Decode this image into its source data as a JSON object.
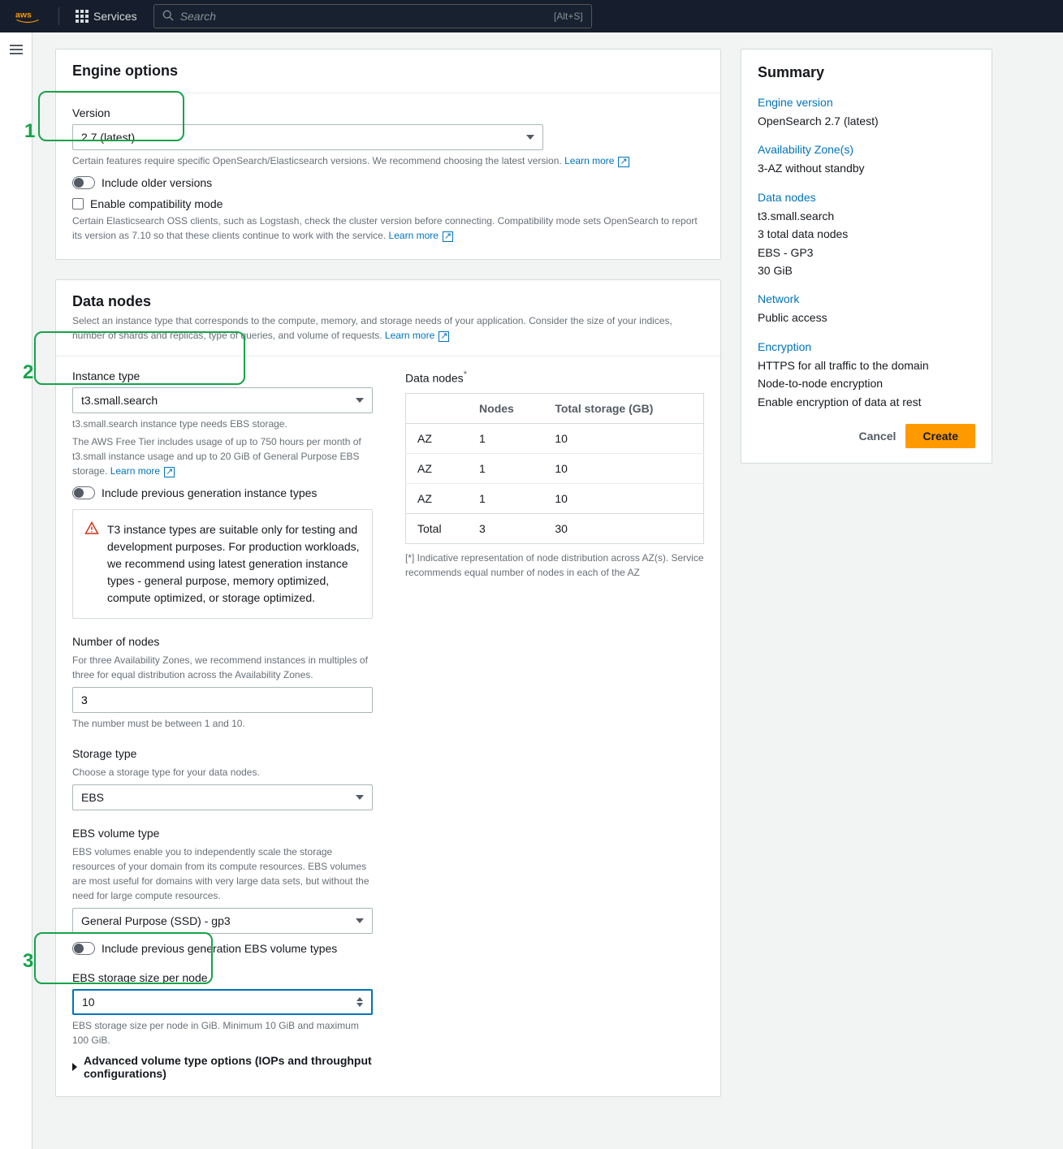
{
  "nav": {
    "services": "Services",
    "search_placeholder": "Search",
    "shortcut": "[Alt+S]"
  },
  "callouts": {
    "c1": "1",
    "c2": "2",
    "c3": "3"
  },
  "engine": {
    "title": "Engine options",
    "version_label": "Version",
    "version_value": "2.7 (latest)",
    "version_hint": "Certain features require specific OpenSearch/Elasticsearch versions. We recommend choosing the latest version.",
    "learn_more": "Learn more",
    "include_older": "Include older versions",
    "compat_label": "Enable compatibility mode",
    "compat_hint": "Certain Elasticsearch OSS clients, such as Logstash, check the cluster version before connecting. Compatibility mode sets OpenSearch to report its version as 7.10 so that these clients continue to work with the service."
  },
  "datanodes": {
    "title": "Data nodes",
    "sub": "Select an instance type that corresponds to the compute, memory, and storage needs of your application. Consider the size of your indices, number of shards and replicas, type of queries, and volume of requests.",
    "learn_more": "Learn more",
    "instance_type_label": "Instance type",
    "instance_type_value": "t3.small.search",
    "instance_type_hint1": "t3.small.search instance type needs EBS storage.",
    "instance_type_hint2_a": "The AWS Free Tier includes usage of up to 750 hours per month of t3.small instance usage and up to 20 GiB of General Purpose EBS storage.",
    "include_prev": "Include previous generation instance types",
    "warn": "T3 instance types are suitable only for testing and development purposes. For production workloads, we recommend using latest generation instance types - general purpose, memory optimized, compute optimized, or storage optimized.",
    "num_nodes_label": "Number of nodes",
    "num_nodes_hint": "For three Availability Zones, we recommend instances in multiples of three for equal distribution across the Availability Zones.",
    "num_nodes_value": "3",
    "num_nodes_constraint": "The number must be between 1 and 10.",
    "storage_type_label": "Storage type",
    "storage_type_hint": "Choose a storage type for your data nodes.",
    "storage_type_value": "EBS",
    "ebs_vol_label": "EBS volume type",
    "ebs_vol_hint": "EBS volumes enable you to independently scale the storage resources of your domain from its compute resources. EBS volumes are most useful for domains with very large data sets, but without the need for large compute resources.",
    "ebs_vol_value": "General Purpose (SSD) - gp3",
    "include_prev_ebs": "Include previous generation EBS volume types",
    "ebs_size_label": "EBS storage size per node",
    "ebs_size_value": "10",
    "ebs_size_hint": "EBS storage size per node in GiB. Minimum 10 GiB and maximum 100 GiB.",
    "advanced": "Advanced volume type options (IOPs and throughput configurations)",
    "table_title": "Data nodes",
    "table_star": "*",
    "th_nodes": "Nodes",
    "th_storage": "Total storage (GB)",
    "rows": [
      {
        "az": "AZ",
        "nodes": "1",
        "storage": "10"
      },
      {
        "az": "AZ",
        "nodes": "1",
        "storage": "10"
      },
      {
        "az": "AZ",
        "nodes": "1",
        "storage": "10"
      }
    ],
    "total_label": "Total",
    "total_nodes": "3",
    "total_storage": "30",
    "table_note": "[*] Indicative representation of node distribution across AZ(s). Service recommends equal number of nodes in each of the AZ"
  },
  "summary": {
    "title": "Summary",
    "engine_label": "Engine version",
    "engine_val": "OpenSearch 2.7 (latest)",
    "az_label": "Availability Zone(s)",
    "az_val": "3-AZ without standby",
    "dn_label": "Data nodes",
    "dn_vals": [
      "t3.small.search",
      "3 total data nodes",
      "EBS - GP3",
      "30 GiB"
    ],
    "net_label": "Network",
    "net_val": "Public access",
    "enc_label": "Encryption",
    "enc_vals": [
      "HTTPS for all traffic to the domain",
      "Node-to-node encryption",
      "Enable encryption of data at rest"
    ],
    "cancel": "Cancel",
    "create": "Create"
  }
}
